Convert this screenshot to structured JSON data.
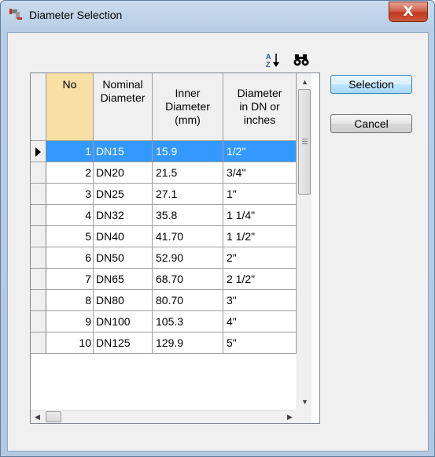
{
  "window": {
    "title": "Diameter Selection",
    "close_glyph": "X",
    "icon": "pipe-app-icon"
  },
  "toolbar": {
    "sort_icon": "sort-az-icon",
    "find_icon": "binoculars-icon"
  },
  "table": {
    "headers": {
      "no": "No",
      "nominal_line1": "Nominal",
      "nominal_line2": "Diameter",
      "inner_line1": "Inner",
      "inner_line2": "Diameter",
      "inner_line3": "(mm)",
      "diam_line1": "Diameter",
      "diam_line2": "in DN or",
      "diam_line3": "inches"
    },
    "selected_row": 0,
    "rows": [
      {
        "no": "1",
        "nominal": "DN15",
        "inner": "15.9",
        "inches": "1/2\""
      },
      {
        "no": "2",
        "nominal": "DN20",
        "inner": "21.5",
        "inches": "3/4\""
      },
      {
        "no": "3",
        "nominal": "DN25",
        "inner": "27.1",
        "inches": "1\""
      },
      {
        "no": "4",
        "nominal": "DN32",
        "inner": "35.8",
        "inches": "1 1/4\""
      },
      {
        "no": "5",
        "nominal": "DN40",
        "inner": "41.70",
        "inches": "1 1/2\""
      },
      {
        "no": "6",
        "nominal": "DN50",
        "inner": "52.90",
        "inches": "2\""
      },
      {
        "no": "7",
        "nominal": "DN65",
        "inner": "68.70",
        "inches": "2 1/2\""
      },
      {
        "no": "8",
        "nominal": "DN80",
        "inner": "80.70",
        "inches": "3\""
      },
      {
        "no": "9",
        "nominal": "DN100",
        "inner": "105.3",
        "inches": "4\""
      },
      {
        "no": "10",
        "nominal": "DN125",
        "inner": "129.9",
        "inches": "5\""
      }
    ]
  },
  "buttons": {
    "selection": "Selection",
    "cancel": "Cancel"
  },
  "colors": {
    "selection_highlight": "#3399ff",
    "no_column_header": "#f8dfa4"
  }
}
